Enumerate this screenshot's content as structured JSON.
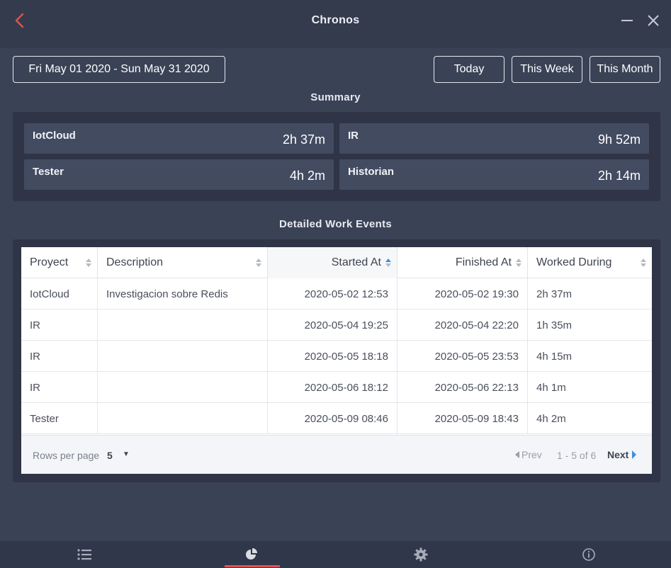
{
  "window": {
    "title": "Chronos",
    "back_icon": "chevron-left-icon",
    "minimize_icon": "minimize-icon",
    "close_icon": "close-icon",
    "accent_color": "#e05252"
  },
  "toolbar": {
    "date_range": "Fri May 01 2020 - Sun May 31 2020",
    "today_label": "Today",
    "this_week_label": "This Week",
    "this_month_label": "This Month"
  },
  "summary": {
    "title": "Summary",
    "items": [
      {
        "name": "IotCloud",
        "time": "2h 37m"
      },
      {
        "name": "IR",
        "time": "9h 52m"
      },
      {
        "name": "Tester",
        "time": "4h 2m"
      },
      {
        "name": "Historian",
        "time": "2h 14m"
      }
    ]
  },
  "events": {
    "title": "Detailed Work Events",
    "columns": [
      "Proyect",
      "Description",
      "Started At",
      "Finished At",
      "Worked During"
    ],
    "sorted_column": "Started At",
    "rows": [
      {
        "project": "IotCloud",
        "description": "Investigacion sobre Redis",
        "started": "2020-05-02 12:53",
        "finished": "2020-05-02 19:30",
        "duration": "2h 37m"
      },
      {
        "project": "IR",
        "description": "",
        "started": "2020-05-04 19:25",
        "finished": "2020-05-04 22:20",
        "duration": "1h 35m"
      },
      {
        "project": "IR",
        "description": "",
        "started": "2020-05-05 18:18",
        "finished": "2020-05-05 23:53",
        "duration": "4h 15m"
      },
      {
        "project": "IR",
        "description": "",
        "started": "2020-05-06 18:12",
        "finished": "2020-05-06 22:13",
        "duration": "4h 1m"
      },
      {
        "project": "Tester",
        "description": "",
        "started": "2020-05-09 08:46",
        "finished": "2020-05-09 18:43",
        "duration": "4h 2m"
      }
    ],
    "pagination": {
      "rows_per_page_label": "Rows per page",
      "rows_per_page": "5",
      "prev_label": "Prev",
      "range_label": "1 - 5 of 6",
      "next_label": "Next"
    }
  },
  "nav": {
    "items": [
      {
        "icon": "list-icon"
      },
      {
        "icon": "pie-chart-icon",
        "active": true
      },
      {
        "icon": "gear-icon"
      },
      {
        "icon": "info-icon"
      }
    ]
  }
}
